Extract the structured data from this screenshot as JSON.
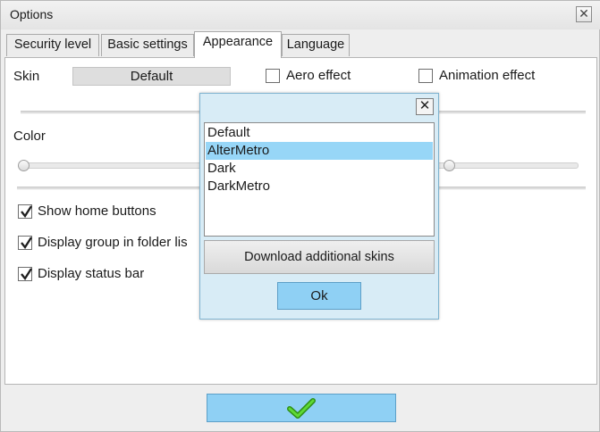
{
  "window": {
    "title": "Options"
  },
  "tabs": [
    {
      "label": "Security level",
      "active": false
    },
    {
      "label": "Basic settings",
      "active": false
    },
    {
      "label": "Appearance",
      "active": true
    },
    {
      "label": "Language",
      "active": false
    }
  ],
  "appearance": {
    "skin_label": "Skin",
    "skin_value": "Default",
    "aero_label": "Aero effect",
    "aero_checked": false,
    "animation_label": "Animation effect",
    "animation_checked": false,
    "color_label": "Color",
    "options": [
      {
        "label": "Show home buttons",
        "checked": true
      },
      {
        "label": "Display group in folder lis",
        "checked": true
      },
      {
        "label": "Display status bar",
        "checked": true
      }
    ]
  },
  "skin_dialog": {
    "items": [
      "Default",
      "AlterMetro",
      "Dark",
      "DarkMetro"
    ],
    "selected": "AlterMetro",
    "download_label": "Download additional skins",
    "ok_label": "Ok"
  },
  "colors": {
    "accent": "#8fd0f4",
    "selection": "#97d6f7",
    "checkmark": "#3cbf1a"
  }
}
